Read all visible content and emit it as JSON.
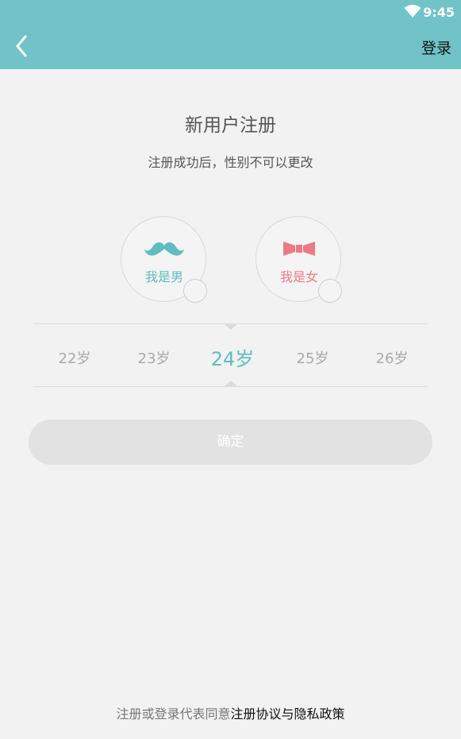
{
  "status_bar": {
    "time": "9:45",
    "wifi_icon": "wifi-icon"
  },
  "app_bar": {
    "back_icon": "back-arrow-icon",
    "login_label": "登录",
    "color": "#71c3c7"
  },
  "page": {
    "title": "新用户注册",
    "subtitle": "注册成功后，性别不可以更改"
  },
  "gender": {
    "male": {
      "label": "我是男",
      "icon": "mustache-icon",
      "color": "#5fbcc1"
    },
    "female": {
      "label": "我是女",
      "icon": "bow-tie-icon",
      "color": "#ec7a85"
    }
  },
  "age_picker": {
    "options": [
      "22岁",
      "23岁",
      "24岁",
      "25岁",
      "26岁"
    ],
    "selected": "24岁"
  },
  "confirm_label": "确定",
  "footer": {
    "prefix": "注册或登录代表同意",
    "agreement": "注册协议",
    "conjunction": "与",
    "privacy": "隐私政策"
  }
}
